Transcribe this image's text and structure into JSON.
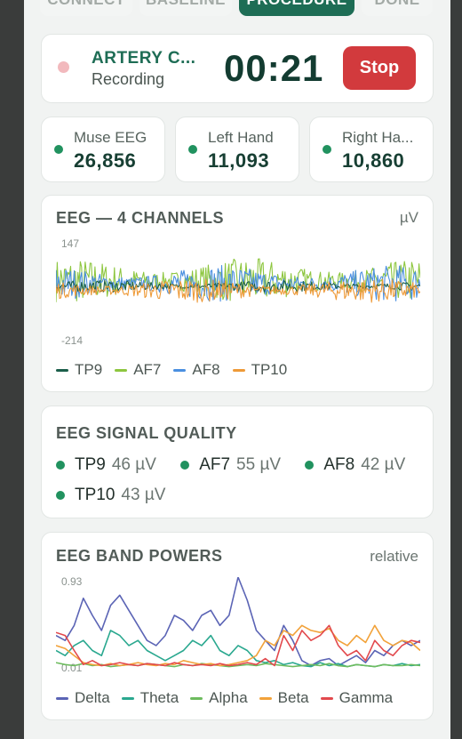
{
  "steps": [
    {
      "label": "CONNECT",
      "state": "done"
    },
    {
      "label": "BASELINE",
      "state": "done"
    },
    {
      "label": "PROCEDURE",
      "state": "active"
    },
    {
      "label": "DONE",
      "state": "pending"
    }
  ],
  "recording": {
    "title": "ARTERY C...",
    "status": "Recording",
    "timer": "00:21",
    "stop_label": "Stop"
  },
  "devices": [
    {
      "name": "Muse EEG",
      "count": "26,856"
    },
    {
      "name": "Left Hand",
      "count": "11,093"
    },
    {
      "name": "Right Ha...",
      "count": "10,860"
    }
  ],
  "eeg_chart": {
    "title": "EEG — 4 CHANNELS",
    "unit": "µV",
    "y_max_label": "147",
    "y_min_label": "-214"
  },
  "signal_quality": {
    "title": "EEG SIGNAL QUALITY",
    "channels": [
      {
        "name": "TP9",
        "value": "46 µV"
      },
      {
        "name": "AF7",
        "value": "55 µV"
      },
      {
        "name": "AF8",
        "value": "42 µV"
      },
      {
        "name": "TP10",
        "value": "43 µV"
      }
    ]
  },
  "band_chart": {
    "title": "EEG BAND POWERS",
    "unit": "relative",
    "y_max_label": "0.93",
    "y_min_label": "0.01"
  },
  "chart_data": [
    {
      "type": "line",
      "title": "EEG — 4 CHANNELS",
      "ylabel": "µV",
      "ylim": [
        -214,
        147
      ],
      "n_points": 300,
      "series": [
        {
          "name": "TP9",
          "color": "#1b5e4a",
          "center": -20,
          "amplitude": 20
        },
        {
          "name": "AF7",
          "color": "#8dc63f",
          "center": 0,
          "amplitude": 75
        },
        {
          "name": "AF8",
          "color": "#4a8fe0",
          "center": -10,
          "amplitude": 60
        },
        {
          "name": "TP10",
          "color": "#ee9a38",
          "center": -35,
          "amplitude": 40
        }
      ]
    },
    {
      "type": "line",
      "title": "EEG BAND POWERS",
      "ylabel": "relative",
      "ylim": [
        0.01,
        0.93
      ],
      "x": [
        0,
        1,
        2,
        3,
        4,
        5,
        6,
        7,
        8,
        9,
        10,
        11,
        12,
        13,
        14,
        15,
        16,
        17,
        18,
        19,
        20,
        21,
        22,
        23,
        24,
        25,
        26,
        27,
        28,
        29,
        30,
        31,
        32,
        33,
        34,
        35,
        36,
        37,
        38,
        39,
        40
      ],
      "series": [
        {
          "name": "Delta",
          "color": "#5b64b5",
          "values": [
            0.35,
            0.3,
            0.45,
            0.72,
            0.55,
            0.4,
            0.65,
            0.75,
            0.6,
            0.45,
            0.3,
            0.25,
            0.35,
            0.55,
            0.5,
            0.4,
            0.55,
            0.6,
            0.45,
            0.55,
            0.93,
            0.7,
            0.4,
            0.3,
            0.2,
            0.45,
            0.3,
            0.1,
            0.05,
            0.1,
            0.12,
            0.05,
            0.1,
            0.15,
            0.08,
            0.2,
            0.15,
            0.25,
            0.3,
            0.25,
            0.3
          ]
        },
        {
          "name": "Theta",
          "color": "#2aa88f",
          "values": [
            0.2,
            0.15,
            0.25,
            0.3,
            0.2,
            0.15,
            0.4,
            0.35,
            0.25,
            0.3,
            0.2,
            0.15,
            0.1,
            0.15,
            0.2,
            0.3,
            0.25,
            0.35,
            0.2,
            0.15,
            0.25,
            0.2,
            0.1,
            0.08,
            0.1,
            0.06,
            0.08,
            0.05,
            0.04,
            0.08,
            0.05,
            0.07,
            0.04,
            0.06,
            0.05,
            0.04,
            0.06,
            0.05,
            0.07,
            0.05,
            0.06
          ]
        },
        {
          "name": "Alpha",
          "color": "#6dbb5e",
          "values": [
            0.08,
            0.06,
            0.05,
            0.07,
            0.05,
            0.06,
            0.04,
            0.05,
            0.06,
            0.05,
            0.07,
            0.06,
            0.05,
            0.04,
            0.06,
            0.05,
            0.07,
            0.06,
            0.05,
            0.04,
            0.05,
            0.06,
            0.05,
            0.07,
            0.06,
            0.05,
            0.04,
            0.05,
            0.06,
            0.05,
            0.07,
            0.05,
            0.04,
            0.06,
            0.05,
            0.04,
            0.06,
            0.05,
            0.05,
            0.06,
            0.05
          ]
        },
        {
          "name": "Beta",
          "color": "#f2a23a",
          "values": [
            0.25,
            0.22,
            0.15,
            0.08,
            0.06,
            0.05,
            0.07,
            0.05,
            0.06,
            0.08,
            0.06,
            0.05,
            0.07,
            0.06,
            0.1,
            0.08,
            0.06,
            0.07,
            0.05,
            0.06,
            0.08,
            0.1,
            0.15,
            0.3,
            0.25,
            0.4,
            0.35,
            0.45,
            0.4,
            0.38,
            0.42,
            0.3,
            0.25,
            0.35,
            0.28,
            0.45,
            0.3,
            0.25,
            0.3,
            0.28,
            0.2
          ]
        },
        {
          "name": "Gamma",
          "color": "#e2494d",
          "values": [
            0.38,
            0.35,
            0.2,
            0.06,
            0.1,
            0.05,
            0.06,
            0.08,
            0.06,
            0.05,
            0.07,
            0.06,
            0.05,
            0.08,
            0.06,
            0.05,
            0.06,
            0.05,
            0.07,
            0.05,
            0.06,
            0.08,
            0.06,
            0.12,
            0.05,
            0.35,
            0.2,
            0.4,
            0.3,
            0.35,
            0.45,
            0.25,
            0.15,
            0.2,
            0.1,
            0.3,
            0.2,
            0.15,
            0.25,
            0.3,
            0.28
          ]
        }
      ]
    }
  ]
}
